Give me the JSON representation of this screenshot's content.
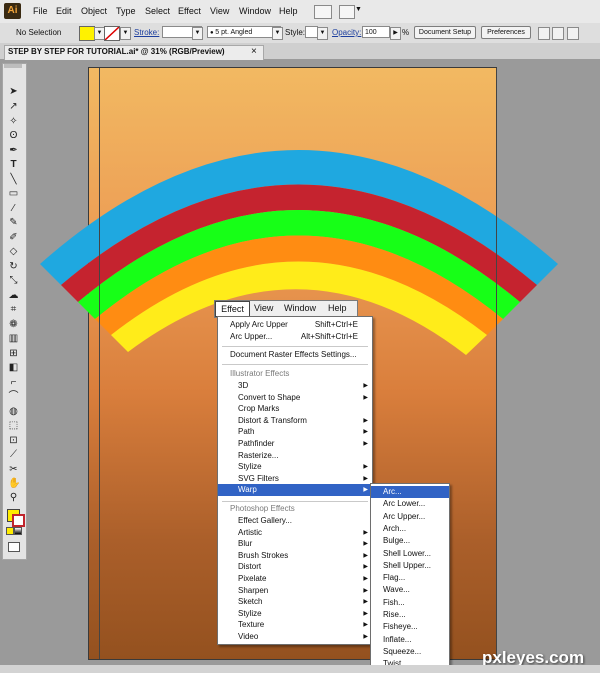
{
  "app": {
    "logo": "Ai"
  },
  "menubar": {
    "items": [
      "File",
      "Edit",
      "Object",
      "Type",
      "Select",
      "Effect",
      "View",
      "Window",
      "Help"
    ]
  },
  "control": {
    "selection": "No Selection",
    "stroke_label": "Stroke:",
    "brush_value": "5 pt. Angled",
    "style_label": "Style:",
    "opacity_label": "Opacity:",
    "opacity_value": "100",
    "opacity_unit": "%",
    "doc_setup": "Document Setup",
    "preferences": "Preferences"
  },
  "document": {
    "tab_title": "STEP BY STEP FOR TUTORIAL.ai* @ 31% (RGB/Preview)",
    "close": "×"
  },
  "colors": {
    "fill": "#fff200",
    "stroke": "#c0242c",
    "menu_highlight": "#3163c5"
  },
  "rainbow": {
    "bands": [
      "#1fa8e0",
      "#c5232f",
      "#17ff17",
      "#ff8c12",
      "#ffec1a"
    ]
  },
  "menu_head": {
    "items": [
      "Effect",
      "View",
      "Window",
      "Help"
    ]
  },
  "effect_menu": {
    "apply": {
      "label": "Apply Arc Upper",
      "shortcut": "Shift+Ctrl+E"
    },
    "last": {
      "label": "Arc Upper...",
      "shortcut": "Alt+Shift+Ctrl+E"
    },
    "raster": {
      "label": "Document Raster Effects Settings..."
    },
    "illustrator_title": "Illustrator Effects",
    "illustrator_items": [
      {
        "label": "3D",
        "sub": true
      },
      {
        "label": "Convert to Shape",
        "sub": true
      },
      {
        "label": "Crop Marks",
        "sub": false
      },
      {
        "label": "Distort & Transform",
        "sub": true
      },
      {
        "label": "Path",
        "sub": true
      },
      {
        "label": "Pathfinder",
        "sub": true
      },
      {
        "label": "Rasterize...",
        "sub": false
      },
      {
        "label": "Stylize",
        "sub": true
      },
      {
        "label": "SVG Filters",
        "sub": true
      },
      {
        "label": "Warp",
        "sub": true
      }
    ],
    "photoshop_title": "Photoshop Effects",
    "photoshop_items": [
      {
        "label": "Effect Gallery...",
        "sub": false
      },
      {
        "label": "Artistic",
        "sub": true
      },
      {
        "label": "Blur",
        "sub": true
      },
      {
        "label": "Brush Strokes",
        "sub": true
      },
      {
        "label": "Distort",
        "sub": true
      },
      {
        "label": "Pixelate",
        "sub": true
      },
      {
        "label": "Sharpen",
        "sub": true
      },
      {
        "label": "Sketch",
        "sub": true
      },
      {
        "label": "Stylize",
        "sub": true
      },
      {
        "label": "Texture",
        "sub": true
      },
      {
        "label": "Video",
        "sub": true
      }
    ]
  },
  "warp_menu": {
    "items": [
      "Arc...",
      "Arc Lower...",
      "Arc Upper...",
      "Arch...",
      "Bulge...",
      "Shell Lower...",
      "Shell Upper...",
      "Flag...",
      "Wave...",
      "Fish...",
      "Rise...",
      "Fisheye...",
      "Inflate...",
      "Squeeze...",
      "Twist..."
    ]
  },
  "watermark": "pxleyes.com"
}
